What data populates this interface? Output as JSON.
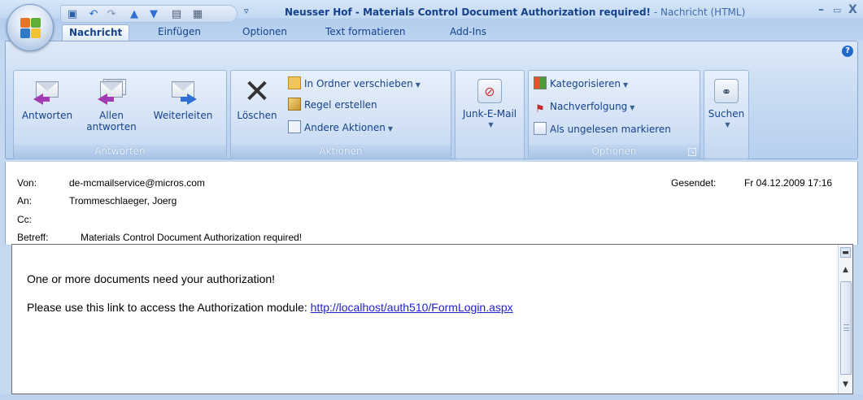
{
  "window": {
    "title": "Neusser Hof - Materials Control Document Authorization required!",
    "title_suffix": " - Nachricht (HTML)",
    "controls": {
      "minimize": "–",
      "maximize": "▭",
      "close": "X"
    }
  },
  "quick_access": {
    "icons": [
      "save-icon",
      "undo-icon",
      "redo-icon",
      "previous-icon",
      "next-icon",
      "copy-icon",
      "print-icon"
    ],
    "more": "▿"
  },
  "tabs": [
    "Nachricht",
    "Einfügen",
    "Optionen",
    "Text formatieren",
    "Add-Ins"
  ],
  "ribbon": {
    "groups": {
      "antworten": {
        "label": "Antworten",
        "reply": "Antworten",
        "reply_all_1": "Allen",
        "reply_all_2": "antworten",
        "forward": "Weiterleiten"
      },
      "aktionen": {
        "label": "Aktionen",
        "delete": "Löschen",
        "move": "In Ordner verschieben",
        "rule": "Regel erstellen",
        "other": "Andere Aktionen"
      },
      "junk": {
        "label": "Junk-E-Mail"
      },
      "optionen": {
        "label": "Optionen",
        "categorize": "Kategorisieren",
        "followup": "Nachverfolgung",
        "unread": "Als ungelesen markieren"
      },
      "suchen": {
        "label": "Suchen"
      }
    }
  },
  "header": {
    "from_label": "Von:",
    "from": "de-mcmailservice@micros.com",
    "to_label": "An:",
    "to": "Trommeschlaeger, Joerg",
    "cc_label": "Cc:",
    "cc": "",
    "subject_label": "Betreff:",
    "subject": "Materials Control Document Authorization required!",
    "sent_label": "Gesendet:",
    "sent": "Fr 04.12.2009 17:16"
  },
  "body": {
    "line1": "One or more documents need your authorization!",
    "line2": "Please use this link to access the Authorization module: ",
    "link": "http://localhost/auth510/FormLogin.aspx"
  },
  "colors": {
    "accent": "#15428b",
    "link": "#2222cc",
    "reply_arrow": "#a33bb4",
    "forward_arrow": "#2f6fd6"
  }
}
